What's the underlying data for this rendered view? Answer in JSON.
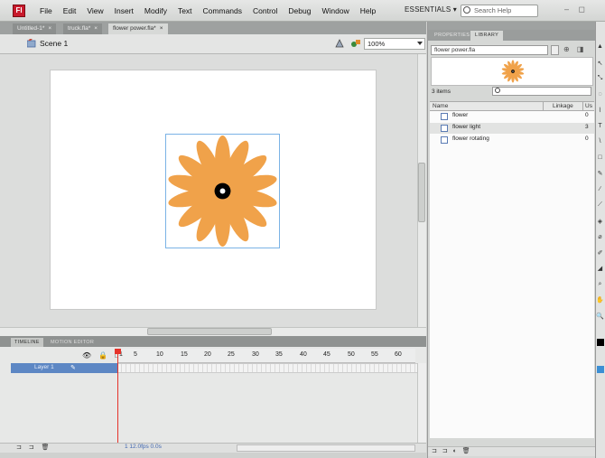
{
  "menubar": {
    "logo": "Fl",
    "items": [
      "File",
      "Edit",
      "View",
      "Insert",
      "Modify",
      "Text",
      "Commands",
      "Control",
      "Debug",
      "Window",
      "Help"
    ],
    "workspace": "ESSENTIALS ▾",
    "search_placeholder": "Search Help",
    "window_controls": "– ◻"
  },
  "doc_tabs": [
    {
      "label": "Untitled-1*",
      "close": "×"
    },
    {
      "label": "truck.fla*",
      "close": "×"
    },
    {
      "label": "flower power.fla*",
      "close": "×"
    }
  ],
  "scene": {
    "label": "Scene 1",
    "zoom": "100%"
  },
  "stage": {
    "background": "#ffffff",
    "petal_color": "#f0a24a",
    "center_color": "#000000"
  },
  "timeline": {
    "tabs": [
      "TIMELINE",
      "MOTION EDITOR"
    ],
    "header_icons": "👁 🔒 □",
    "frame_numbers": [
      "1",
      "5",
      "10",
      "15",
      "20",
      "25",
      "30",
      "35",
      "40",
      "45",
      "50",
      "55",
      "60"
    ],
    "layer_name": "Layer 1",
    "layer_pencil": "✎",
    "footer_icons": "⊐ ⊐ 🗑",
    "status": "1   12.0fps   0.0s"
  },
  "panel": {
    "tabs": [
      "PROPERTIES",
      "LIBRARY"
    ],
    "library_select": "flower power.fla",
    "item_count": "3 items",
    "columns": {
      "name": "Name",
      "linkage": "Linkage",
      "use": "Us"
    },
    "items": [
      {
        "name": "flower",
        "use": "0",
        "selected": false
      },
      {
        "name": "flower light",
        "use": "3",
        "selected": true
      },
      {
        "name": "flower rotating",
        "use": "0",
        "selected": false
      }
    ],
    "footer_icons": "⊐ ⊐ ◐ 🗑"
  },
  "tools": [
    "▲",
    "↖",
    "⤡",
    "◌",
    "⌇",
    "T",
    "\\",
    "□",
    "✎",
    "∕",
    "⟋",
    "◈",
    "⌀",
    "✐",
    "◢",
    "⌕",
    "✋",
    "🔍"
  ]
}
